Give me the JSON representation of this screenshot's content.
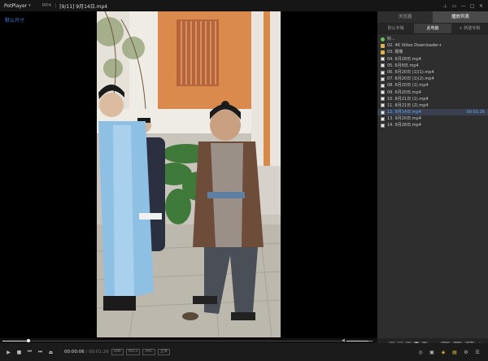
{
  "titlebar": {
    "app_name": "PotPlayer",
    "format": "MP4",
    "separator": "|",
    "title": "[9/11] 9月14日.mp4"
  },
  "osd": {
    "text": "默认尺寸"
  },
  "panel": {
    "tabs": [
      {
        "label": "浏览器",
        "active": false
      },
      {
        "label": "播放列表",
        "active": true
      }
    ],
    "subtabs": [
      {
        "label": "默认专辑",
        "active": false
      },
      {
        "label": "此电脑",
        "active": true
      },
      {
        "label": "+ 新建专辑",
        "active": false
      }
    ],
    "items": [
      {
        "label": "好...",
        "type": "up",
        "current": false,
        "duration": ""
      },
      {
        "label": "02. 4K Video Downloader+",
        "type": "folder",
        "current": false,
        "duration": ""
      },
      {
        "label": "03. 摄像",
        "type": "folder",
        "current": false,
        "duration": ""
      },
      {
        "label": "04. 6月28日.mp4",
        "type": "file",
        "current": false,
        "duration": ""
      },
      {
        "label": "05. 6月8日.mp4",
        "type": "file",
        "current": false,
        "duration": ""
      },
      {
        "label": "06. 6月20日 (1)(1).mp4",
        "type": "file",
        "current": false,
        "duration": ""
      },
      {
        "label": "07. 6月20日 (1)(2).mp4",
        "type": "file",
        "current": false,
        "duration": ""
      },
      {
        "label": "08. 6月20日 (1).mp4",
        "type": "file",
        "current": false,
        "duration": ""
      },
      {
        "label": "09. 6月20日.mp4",
        "type": "file",
        "current": false,
        "duration": ""
      },
      {
        "label": "10. 8月21日 (1).mp4",
        "type": "file",
        "current": false,
        "duration": ""
      },
      {
        "label": "11. 8月21日 (2).mp4",
        "type": "file",
        "current": false,
        "duration": ""
      },
      {
        "label": "12. 9月14日.mp4",
        "type": "file",
        "current": true,
        "duration": "00:01:26"
      },
      {
        "label": "13. 9月20日.mp4",
        "type": "file",
        "current": false,
        "duration": ""
      },
      {
        "label": "14. 9月28日.mp4",
        "type": "file",
        "current": false,
        "duration": ""
      }
    ],
    "footer": {
      "buttons": [
        "+",
        "−",
        "▲",
        "▼",
        "≡"
      ],
      "text_buttons": [
        "添加",
        "删除",
        "排序"
      ],
      "search_icon": "search-icon"
    }
  },
  "playback": {
    "current_time": "00:00:06",
    "separator": " / ",
    "total_time": "00:01:26",
    "progress": 0.07,
    "volume": 0.85,
    "tags": [
      "S/W",
      "AVC1",
      "AAC",
      "立体"
    ]
  },
  "colors": {
    "accent_blue": "#3d7fd6",
    "playlist_current": "#6aa6e8",
    "folder": "#d9b44a",
    "yellow_button": "#e0c52c"
  }
}
